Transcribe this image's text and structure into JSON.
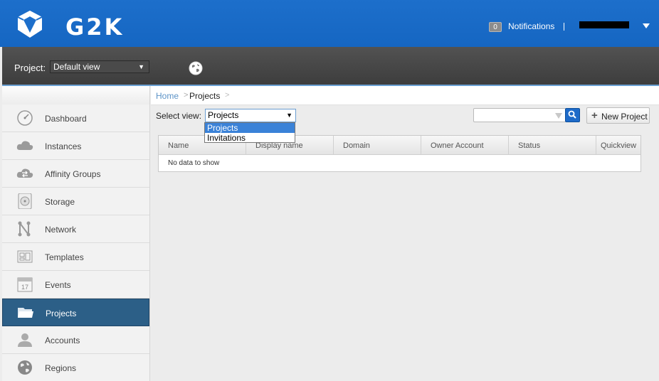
{
  "header": {
    "logo_text": "G2K",
    "notifications_count": "0",
    "notifications_label": "Notifications"
  },
  "project_bar": {
    "label": "Project:",
    "selected": "Default view"
  },
  "sidebar": {
    "items": [
      {
        "label": "Dashboard",
        "icon": "dashboard-icon"
      },
      {
        "label": "Instances",
        "icon": "cloud-icon"
      },
      {
        "label": "Affinity Groups",
        "icon": "affinity-cloud-icon"
      },
      {
        "label": "Storage",
        "icon": "storage-disk-icon"
      },
      {
        "label": "Network",
        "icon": "network-icon"
      },
      {
        "label": "Templates",
        "icon": "templates-icon"
      },
      {
        "label": "Events",
        "icon": "calendar-icon"
      },
      {
        "label": "Projects",
        "icon": "folder-icon",
        "active": true
      },
      {
        "label": "Accounts",
        "icon": "user-icon"
      },
      {
        "label": "Regions",
        "icon": "globe-icon"
      }
    ]
  },
  "breadcrumb": {
    "home": "Home",
    "sep": ">",
    "current": "Projects",
    "trail_sep": ">"
  },
  "toolbar": {
    "select_view_label": "Select view:",
    "select_view_value": "Projects",
    "select_options": [
      "Projects",
      "Invitations"
    ],
    "new_project_label": "New Project"
  },
  "table": {
    "columns": [
      "Name",
      "Display name",
      "Domain",
      "Owner Account",
      "Status",
      "Quickview"
    ],
    "empty_text": "No data to show"
  },
  "colors": {
    "header_blue": "#1d6fcb",
    "active_nav": "#2c5f87",
    "link": "#5c93c7",
    "select_highlight": "#3a82d8"
  }
}
